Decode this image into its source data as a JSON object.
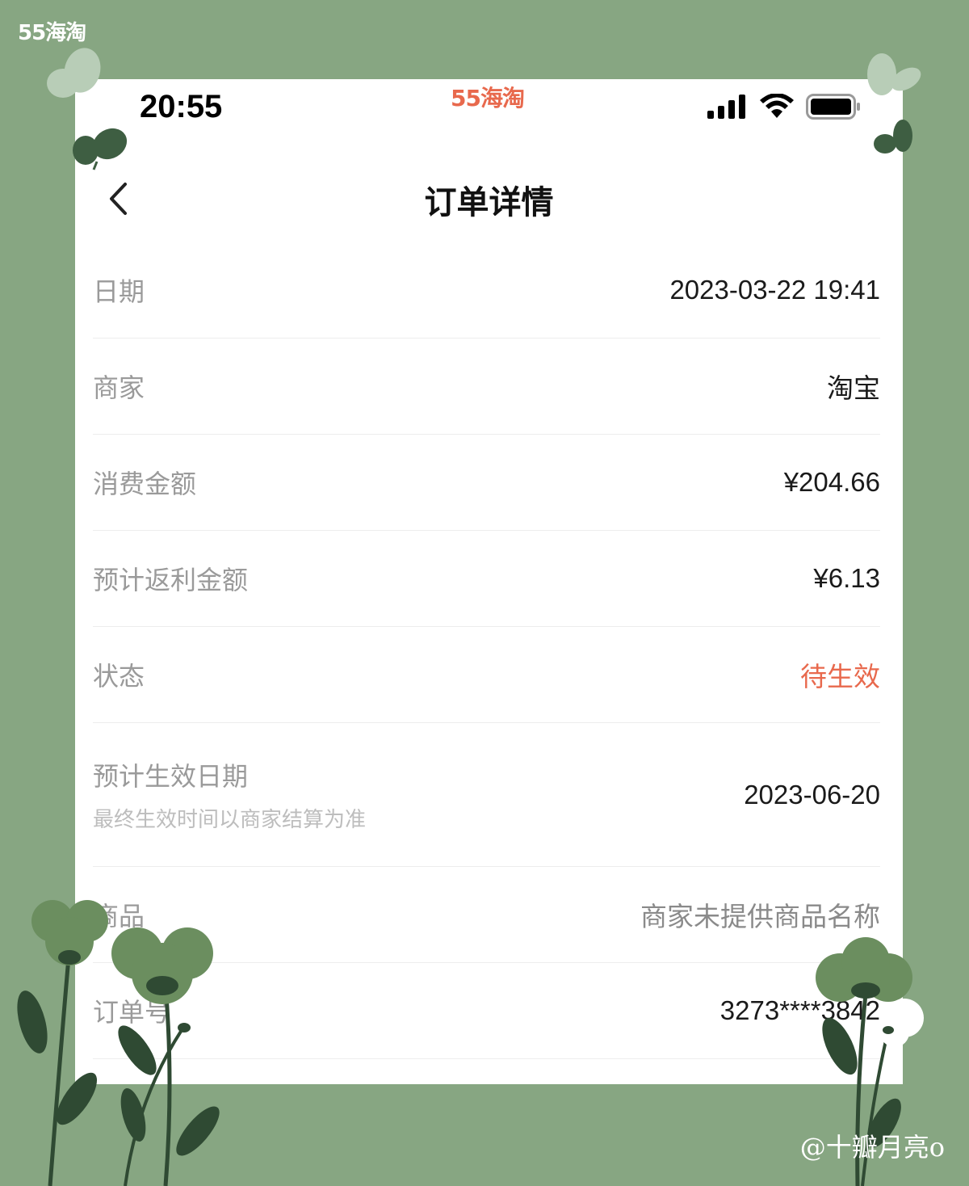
{
  "frame": {
    "watermark": "55海淘",
    "credit": "@十瓣月亮o"
  },
  "status_bar": {
    "time": "20:55",
    "app_watermark": "55海淘",
    "icons": [
      "cellular-signal-icon",
      "wifi-icon",
      "battery-icon"
    ]
  },
  "nav": {
    "back_icon": "chevron-left-icon",
    "title": "订单详情"
  },
  "details": [
    {
      "label": "日期",
      "value": "2023-03-22 19:41"
    },
    {
      "label": "商家",
      "value": "淘宝"
    },
    {
      "label": "消费金额",
      "value": "¥204.66"
    },
    {
      "label": "预计返利金额",
      "value": "¥6.13"
    },
    {
      "label": "状态",
      "value": "待生效"
    },
    {
      "label": "预计生效日期",
      "sublabel": "最终生效时间以商家结算为准",
      "value": "2023-06-20"
    },
    {
      "label": "商品",
      "value": "商家未提供商品名称"
    },
    {
      "label": "订单号",
      "value": "3273****3842"
    }
  ],
  "colors": {
    "background": "#87a682",
    "status_accent": "#e8694d",
    "label_gray": "#9a9a9a"
  }
}
